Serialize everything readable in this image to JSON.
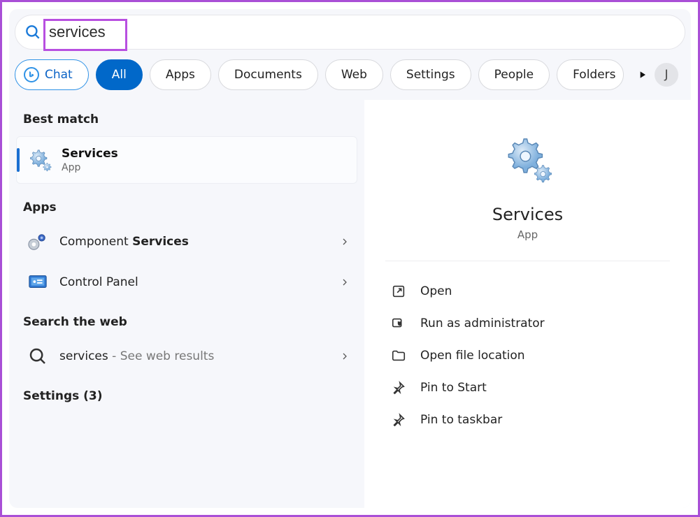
{
  "search": {
    "value": "services"
  },
  "filters": {
    "chat": "Chat",
    "items": [
      "All",
      "Apps",
      "Documents",
      "Web",
      "Settings",
      "People",
      "Folders"
    ]
  },
  "avatar_initial": "J",
  "left": {
    "best_match_header": "Best match",
    "best_match": {
      "title": "Services",
      "subtitle": "App"
    },
    "apps_header": "Apps",
    "apps": [
      {
        "label_pre": "Component ",
        "label_bold": "Services"
      },
      {
        "label_pre": "Control Panel",
        "label_bold": ""
      }
    ],
    "web_header": "Search the web",
    "web": {
      "query": "services",
      "hint": " - See web results"
    },
    "settings_header": "Settings (3)"
  },
  "detail": {
    "title": "Services",
    "subtitle": "App",
    "actions": [
      "Open",
      "Run as administrator",
      "Open file location",
      "Pin to Start",
      "Pin to taskbar"
    ]
  }
}
